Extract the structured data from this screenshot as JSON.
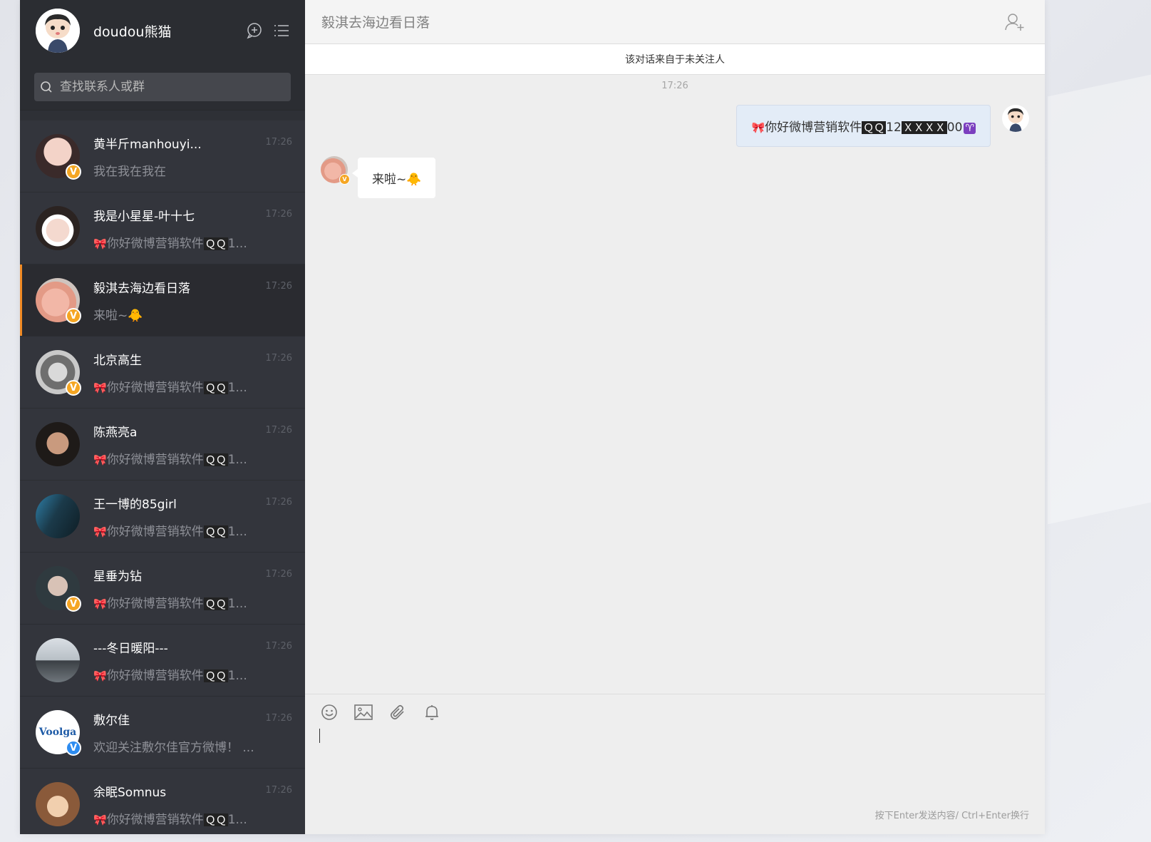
{
  "user": {
    "name": "doudou熊猫"
  },
  "search": {
    "placeholder": "查找联系人或群"
  },
  "contacts": [
    {
      "name": "黄半斤manhouyi...",
      "time": "17:26",
      "message": "我在我在我在",
      "verified": "yellow"
    },
    {
      "name": "我是小星星-叶十七",
      "time": "17:26",
      "message": "你好微博营销软件",
      "qq": "ＱＱ",
      "tail": "1...",
      "verified": "none"
    },
    {
      "name": "毅淇去海边看日落",
      "time": "17:26",
      "message": "来啦~",
      "emoji": "🐥",
      "verified": "yellow",
      "active": true
    },
    {
      "name": "北京高生",
      "time": "17:26",
      "message": "你好微博营销软件",
      "qq": "ＱＱ",
      "tail": "1...",
      "verified": "yellow"
    },
    {
      "name": "陈燕亮a",
      "time": "17:26",
      "message": "你好微博营销软件",
      "qq": "ＱＱ",
      "tail": "1...",
      "verified": "none"
    },
    {
      "name": "王一博的85girl",
      "time": "17:26",
      "message": "你好微博营销软件",
      "qq": "ＱＱ",
      "tail": "1...",
      "verified": "none"
    },
    {
      "name": "星垂为钻",
      "time": "17:26",
      "message": "你好微博营销软件",
      "qq": "ＱＱ",
      "tail": "1...",
      "verified": "yellow"
    },
    {
      "name": "---冬日暖阳---",
      "time": "17:26",
      "message": "你好微博营销软件",
      "qq": "ＱＱ",
      "tail": "1...",
      "verified": "none"
    },
    {
      "name": "敷尔佳",
      "time": "17:26",
      "message": "欢迎关注敷尔佳官方微博！ ...",
      "verified": "blue",
      "logo": "Voolga"
    },
    {
      "name": "余眠Somnus",
      "time": "17:26",
      "message": "你好微博营销软件",
      "qq": "ＱＱ",
      "tail": "1...",
      "verified": "none"
    }
  ],
  "chat": {
    "title": "毅淇去海边看日落",
    "notice": "该对话来自于未关注人",
    "time": "17:26",
    "outgoing": {
      "prefix": "你好微博营销软件",
      "qq": "ＱＱ",
      "mid": "12",
      "masked": "ＸＸＸＸ",
      "suffix": "00",
      "end_emoji": "♈"
    },
    "incoming": {
      "text": "来啦~",
      "emoji": "🐥"
    }
  },
  "composer": {
    "hint": "按下Enter发送内容/ Ctrl+Enter换行"
  },
  "colors": {
    "sidebar_bg": "#33353c",
    "sidebar_header_bg": "#2b2d32",
    "accent": "#f08a24",
    "verified_yellow": "#f5a623",
    "verified_blue": "#2d8cf0",
    "chat_bg": "#eeeeee",
    "outgoing_bubble": "#e3ecf7"
  }
}
